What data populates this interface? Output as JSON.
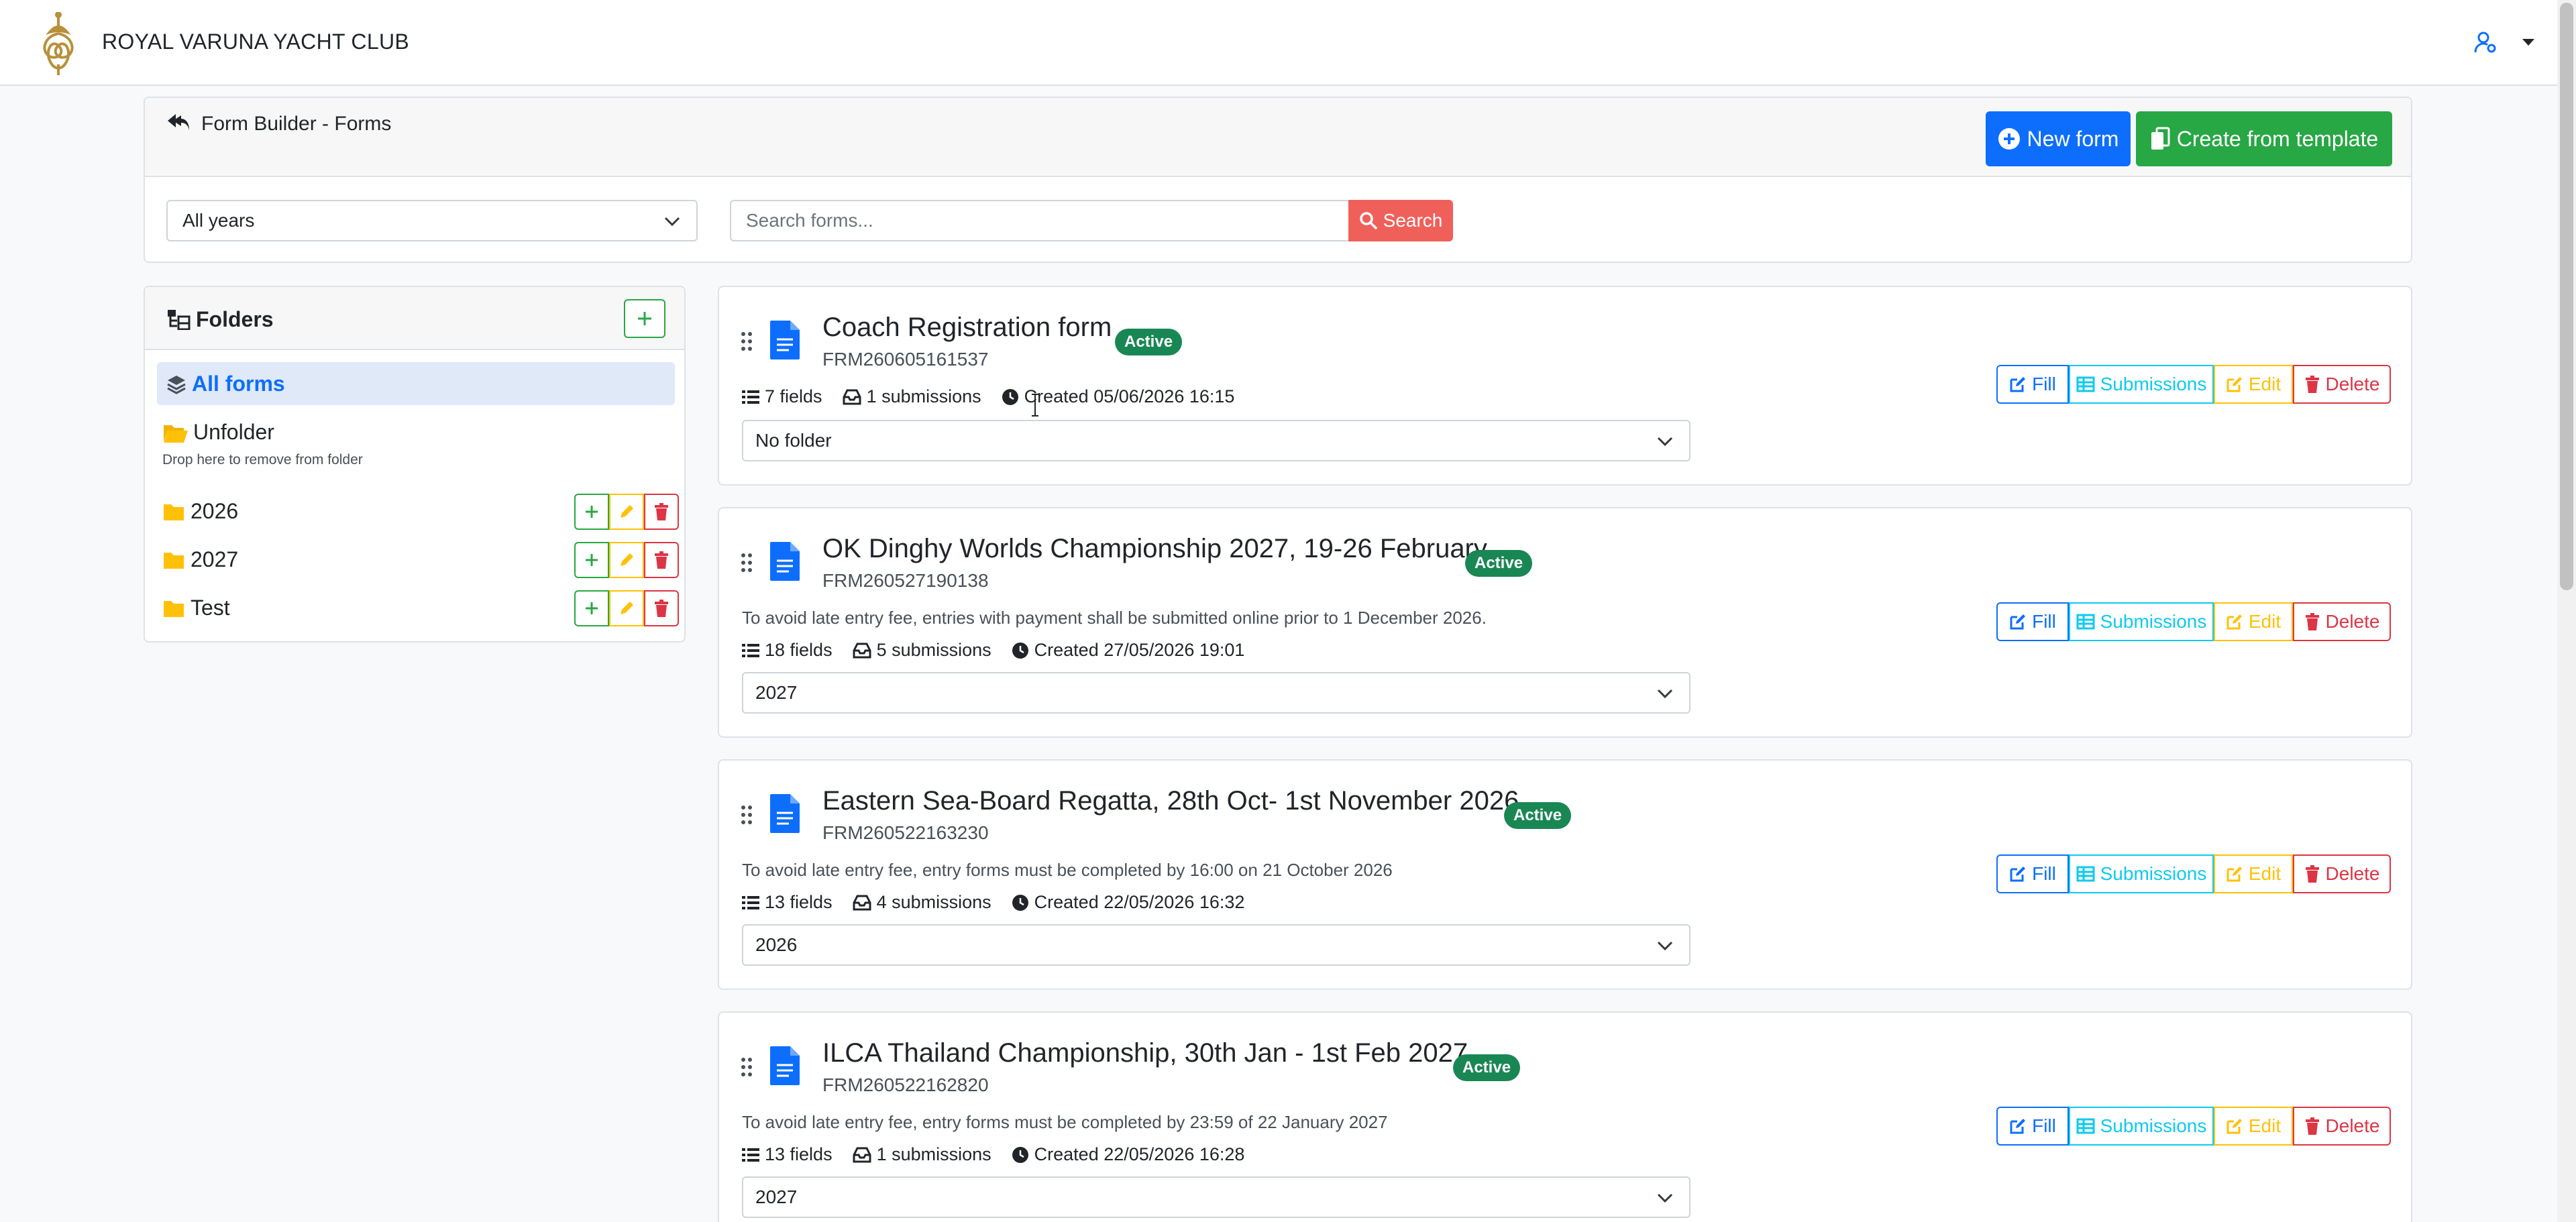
{
  "navbar": {
    "brand": "ROYAL VARUNA YACHT CLUB",
    "logo_icon": "club-crest-logo",
    "user_icon": "user-cog-icon",
    "colors": {
      "brand_gold": "#b8903a",
      "user_icon": "#0d6efd"
    }
  },
  "header": {
    "title": "Form Builder - Forms",
    "new_form_label": "New form",
    "template_label": "Create from template",
    "year_filter": "All years",
    "search_placeholder": "Search forms...",
    "search_label": "Search",
    "colors": {
      "new_form": "#0d6efd",
      "template": "#28a745",
      "search": "#f0605a"
    }
  },
  "sidebar": {
    "title": "Folders",
    "all_forms_label": "All forms",
    "unfolder_label": "Unfolder",
    "unfolder_hint": "Drop here to remove from folder",
    "folders": [
      {
        "name": "2026"
      },
      {
        "name": "2027"
      },
      {
        "name": "Test"
      }
    ]
  },
  "forms": [
    {
      "title": "Coach Registration form",
      "status": "Active",
      "code": "FRM260605161537",
      "description": "",
      "fields": "7 fields",
      "submissions": "1 submissions",
      "created": "Created 05/06/2026 16:15",
      "folder": "No folder"
    },
    {
      "title": "OK Dinghy Worlds Championship 2027, 19-26 February",
      "status": "Active",
      "code": "FRM260527190138",
      "description": "To avoid late entry fee, entries with payment shall be submitted online prior to 1 December 2026.",
      "fields": "18 fields",
      "submissions": "5 submissions",
      "created": "Created 27/05/2026 19:01",
      "folder": "2027"
    },
    {
      "title": "Eastern Sea-Board Regatta, 28th Oct- 1st November 2026",
      "status": "Active",
      "code": "FRM260522163230",
      "description": "To avoid late entry fee, entry forms must be completed by 16:00 on 21 October 2026",
      "fields": "13 fields",
      "submissions": "4 submissions",
      "created": "Created 22/05/2026 16:32",
      "folder": "2026"
    },
    {
      "title": "ILCA Thailand Championship, 30th Jan - 1st Feb 2027",
      "status": "Active",
      "code": "FRM260522162820",
      "description": "To avoid late entry fee, entry forms must be completed by 23:59 of 22 January 2027",
      "fields": "13 fields",
      "submissions": "1 submissions",
      "created": "Created 22/05/2026 16:28",
      "folder": "2027"
    }
  ],
  "actions": {
    "fill": "Fill",
    "submissions": "Submissions",
    "edit": "Edit",
    "delete": "Delete",
    "colors": {
      "fill": "#0d6efd",
      "submissions": "#0dcaf0",
      "edit": "#ffc107",
      "delete": "#dc3545"
    }
  }
}
